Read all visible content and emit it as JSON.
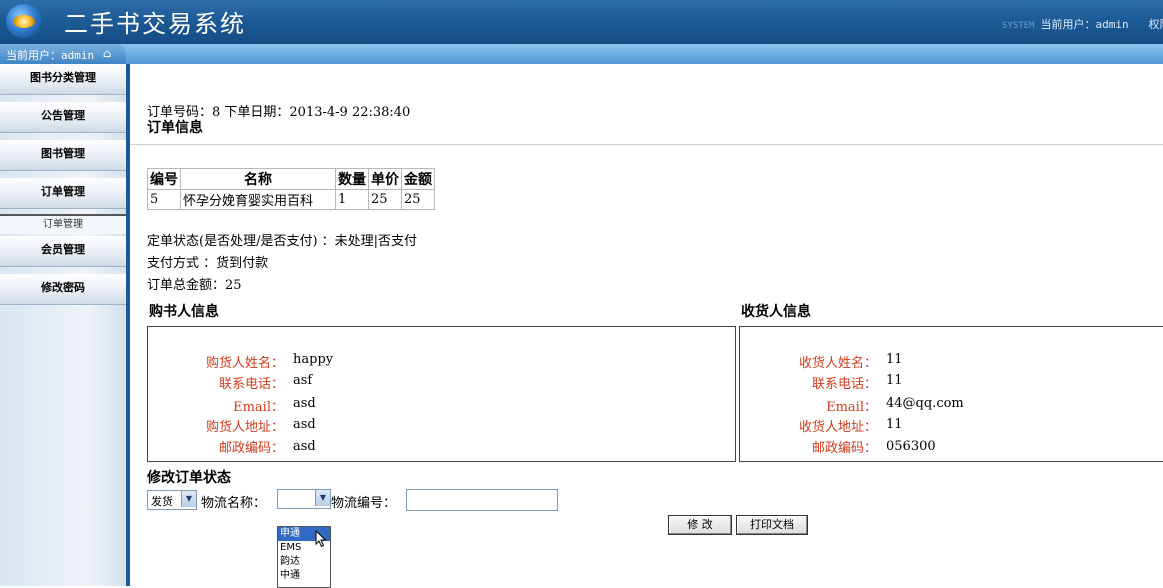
{
  "header": {
    "system_title": "二手书交易系统",
    "faded_text": "SYSTEM",
    "current_user": "当前用户：admin",
    "trailing": "权限"
  },
  "subbar": {
    "user_label": "当前用户：admin"
  },
  "sidebar": {
    "items": [
      {
        "label": "图书分类管理"
      },
      {
        "label": "公告管理"
      },
      {
        "label": "图书管理"
      },
      {
        "label": "订单管理"
      },
      {
        "label": "会员管理"
      },
      {
        "label": "修改密码"
      }
    ],
    "active_sub": "订单管理"
  },
  "order": {
    "meta": "订单号码：8  下单日期：2013-4-9 22:38:40",
    "section_title": "订单信息",
    "table_headers": [
      "编号",
      "名称",
      "数量",
      "单价",
      "金额"
    ],
    "rows": [
      [
        "5",
        "怀孕分娩育婴实用百科",
        "1",
        "25",
        "25"
      ]
    ],
    "status": "定单状态(是否处理/是否支付) ：未处理|否支付",
    "payment": "支付方式 ：货到付款",
    "total": "订单总金额：25"
  },
  "buyer": {
    "title": "购书人信息",
    "fields": [
      {
        "label": "购货人姓名：",
        "value": "happy"
      },
      {
        "label": "联系电话：",
        "value": "asf"
      },
      {
        "label": "Email：",
        "value": "asd"
      },
      {
        "label": "购货人地址：",
        "value": "asd"
      },
      {
        "label": "邮政编码：",
        "value": "asd"
      }
    ]
  },
  "receiver": {
    "title": "收货人信息",
    "fields": [
      {
        "label": "收货人姓名：",
        "value": "11"
      },
      {
        "label": "联系电话：",
        "value": "11"
      },
      {
        "label": "Email：",
        "value": "44@qq.com"
      },
      {
        "label": "收货人地址：",
        "value": "11"
      },
      {
        "label": "邮政编码：",
        "value": "056300"
      }
    ]
  },
  "update": {
    "title": "修改订单状态",
    "status_select": "发货",
    "logistics_label": "物流名称：",
    "logistics_select": "",
    "tracking_label": "物流编号：",
    "tracking_value": "",
    "submit_label": "修 改",
    "print_label": "打印文档",
    "dropdown_options": [
      "申通",
      "EMS",
      "韵达",
      "中通"
    ],
    "dropdown_highlighted": "申通"
  },
  "colors": {
    "header": "#1d5b96",
    "label_red": "#d43b1a",
    "nav_border": "#1b5a98"
  },
  "icons": {
    "home": "home-icon",
    "select_arrow": "chevron-down-icon",
    "cursor": "mouse-pointer-icon"
  }
}
